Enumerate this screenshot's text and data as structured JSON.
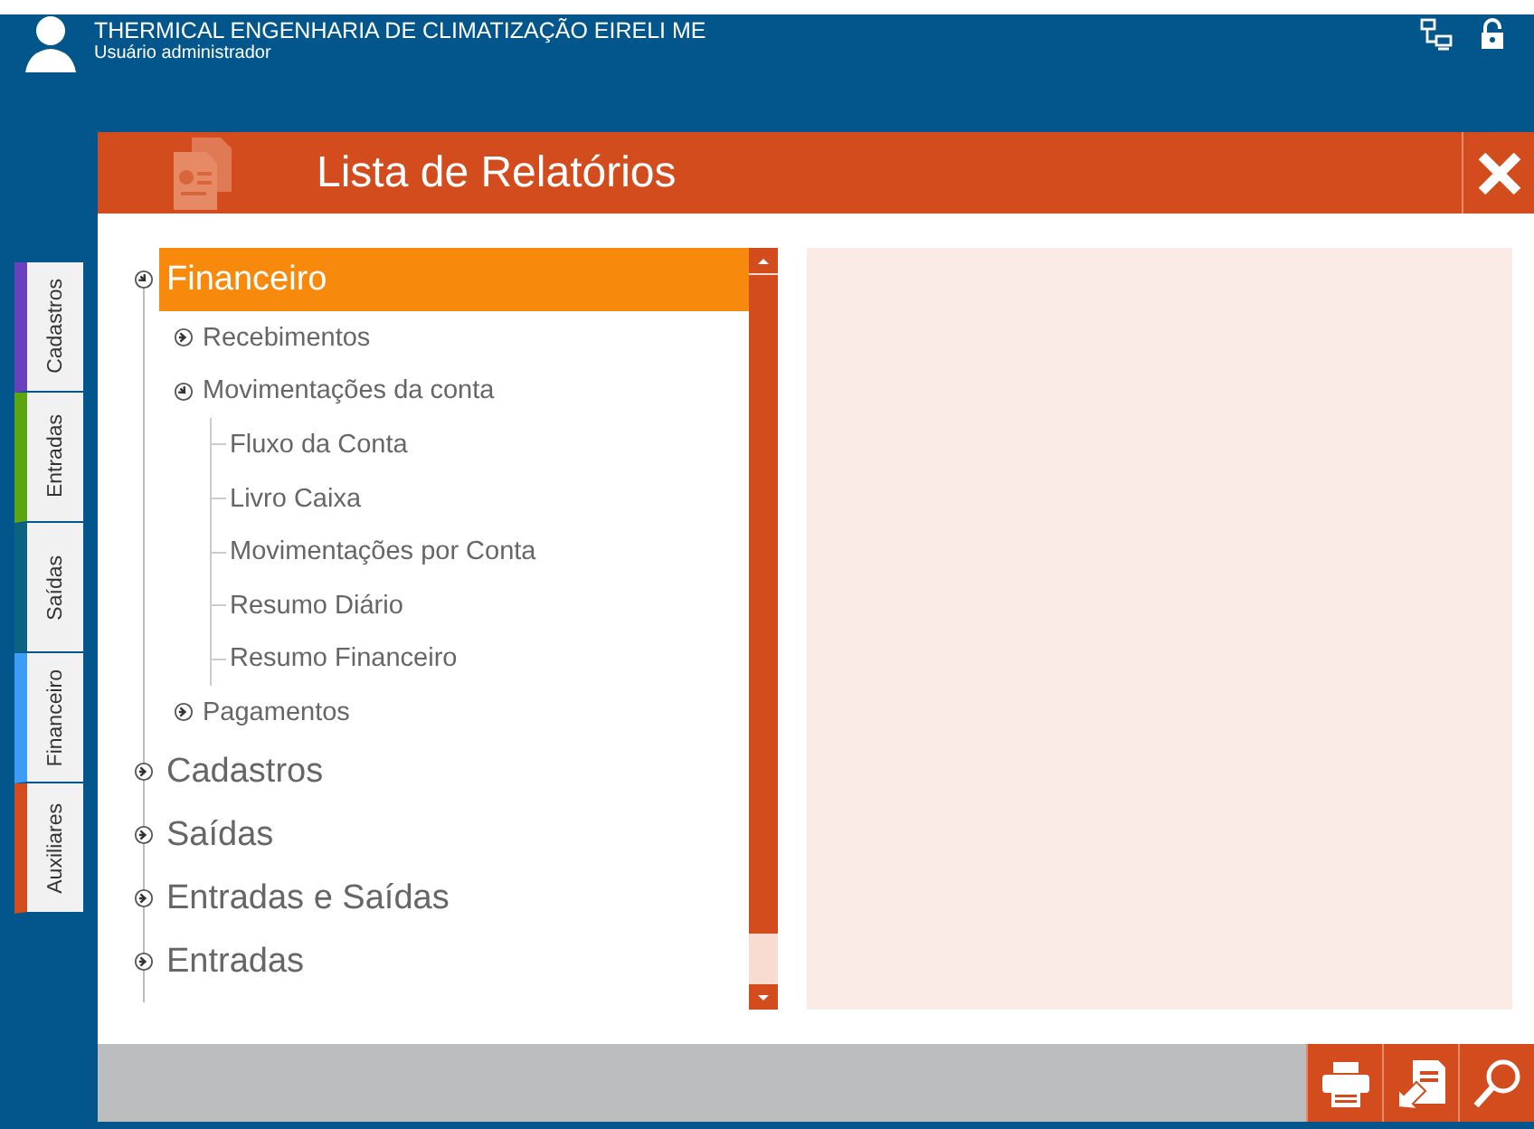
{
  "header": {
    "company": "THERMICAL ENGENHARIA DE CLIMATIZAÇÃO EIRELI ME",
    "user_role": "Usuário administrador"
  },
  "side_tabs": [
    {
      "label": "Cadastros",
      "color": "#6a40bf"
    },
    {
      "label": "Entradas",
      "color": "#5aa512"
    },
    {
      "label": "Saídas",
      "color": "#0b6382"
    },
    {
      "label": "Financeiro",
      "color": "#3d9cf5"
    },
    {
      "label": "Auxiliares",
      "color": "#d24c1e"
    }
  ],
  "dialog": {
    "title": "Lista de Relatórios"
  },
  "tree": [
    {
      "label": "Financeiro",
      "expanded": true,
      "selected": true,
      "children": [
        {
          "label": "Recebimentos",
          "expanded": false,
          "selected": false
        },
        {
          "label": "Movimentações da conta",
          "expanded": true,
          "selected": false,
          "children": [
            {
              "label": "Fluxo da Conta",
              "selected": false
            },
            {
              "label": "Livro Caixa",
              "selected": false
            },
            {
              "label": "Movimentações por Conta",
              "selected": false
            },
            {
              "label": "Resumo Diário",
              "selected": false
            },
            {
              "label": "Resumo Financeiro",
              "selected": false
            }
          ]
        },
        {
          "label": "Pagamentos",
          "expanded": false,
          "selected": false
        }
      ]
    },
    {
      "label": "Cadastros",
      "expanded": false,
      "selected": false
    },
    {
      "label": "Saídas",
      "expanded": false,
      "selected": false
    },
    {
      "label": "Entradas e Saídas",
      "expanded": false,
      "selected": false
    },
    {
      "label": "Entradas",
      "expanded": false,
      "selected": false
    }
  ]
}
